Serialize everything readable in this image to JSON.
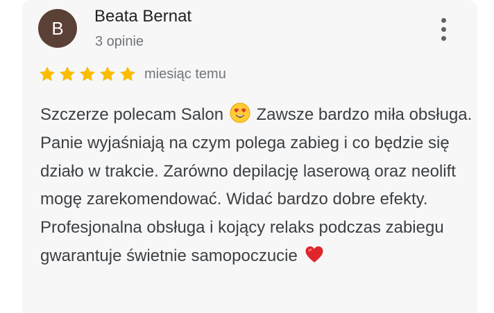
{
  "review": {
    "avatar_letter": "B",
    "author": "Beata Bernat",
    "review_count": "3 opinie",
    "rating": 5,
    "rating_max": 5,
    "time": "miesiąc temu",
    "text_part1": "Szczerze polecam Salon",
    "text_part2": "Zawsze bardzo miła obsługa. Panie wyjaśniają na czym polega zabieg i co będzie się działo w trakcie. Zarówno depilację laserową oraz neolift mogę zarekomendować. Widać bardzo dobre efekty. Profesjonalna obsługa i kojący relaks podczas zabiegu gwarantuje świetnie samopoczucie",
    "emoji_1": "smiling-face-with-heart-eyes-emoji",
    "emoji_2": "red-heart-emoji"
  },
  "colors": {
    "card_background": "#f7f7f8",
    "avatar_background": "#5b4035",
    "star_color": "#fbbc04",
    "name_color": "#202124",
    "meta_color": "#70757a",
    "text_color": "#3c4043"
  },
  "icons": {
    "menu": "more-vert-icon",
    "star": "star-icon"
  }
}
